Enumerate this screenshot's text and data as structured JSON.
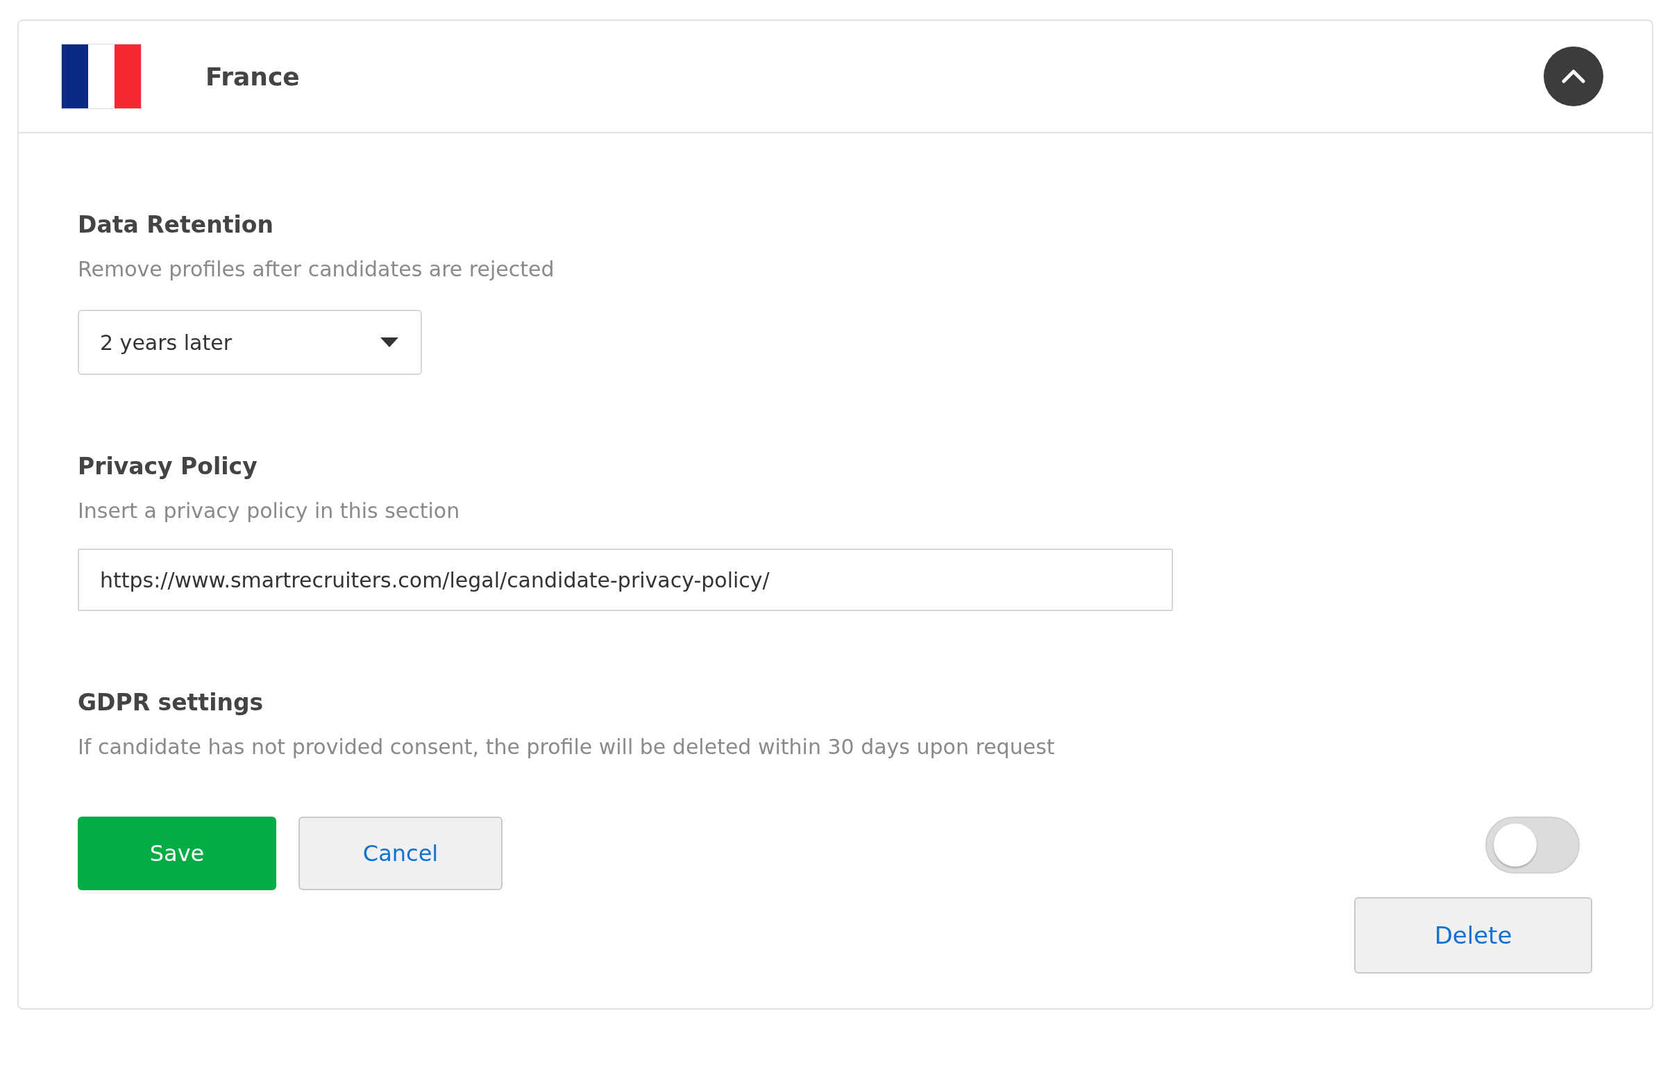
{
  "panel": {
    "country": "France",
    "expanded": true
  },
  "sections": [
    {
      "kind": "select",
      "title": "Data Retention",
      "description": "Remove profiles after candidates are rejected",
      "value": "2 years later"
    },
    {
      "kind": "text",
      "title": "Privacy Policy",
      "description": "Insert a privacy policy in this section",
      "value": "https://www.smartrecruiters.com/legal/candidate-privacy-policy/"
    },
    {
      "kind": "toggle",
      "title": "GDPR settings",
      "description": "If candidate has not provided consent, the profile will be deleted within 30 days upon request",
      "on": false
    }
  ],
  "actions": [
    {
      "label": "Save",
      "kind": "primary"
    },
    {
      "label": "Cancel",
      "kind": "secondary"
    }
  ],
  "delete_button": {
    "label": "Delete"
  }
}
